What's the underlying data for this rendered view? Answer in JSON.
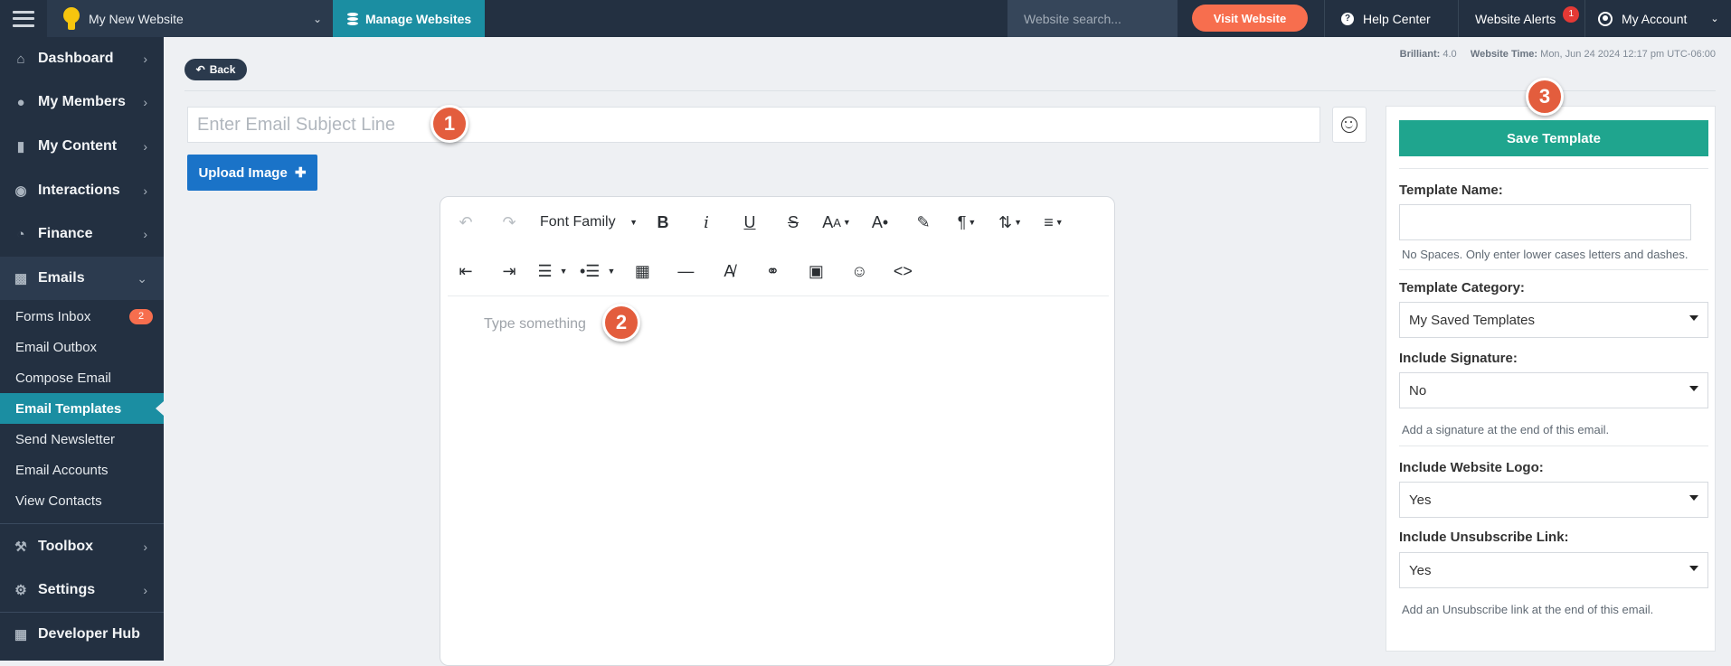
{
  "topbar": {
    "site_name": "My New Website",
    "manage_label": "Manage Websites",
    "search_placeholder": "Website search...",
    "visit_label": "Visit Website",
    "help_label": "Help Center",
    "alerts_label": "Website Alerts",
    "alerts_count": "1",
    "account_label": "My Account"
  },
  "sidebar": {
    "items": [
      {
        "label": "Dashboard",
        "icon": "home-icon"
      },
      {
        "label": "My Members",
        "icon": "users-icon"
      },
      {
        "label": "My Content",
        "icon": "folder-icon"
      },
      {
        "label": "Interactions",
        "icon": "chat-icon"
      },
      {
        "label": "Finance",
        "icon": "pie-chart-icon"
      },
      {
        "label": "Emails",
        "icon": "inbox-icon"
      },
      {
        "label": "Toolbox",
        "icon": "wrench-icon"
      },
      {
        "label": "Settings",
        "icon": "gear-icon"
      },
      {
        "label": "Developer Hub",
        "icon": "grid-icon"
      }
    ],
    "email_sub": [
      {
        "label": "Forms Inbox",
        "badge": "2"
      },
      {
        "label": "Email Outbox"
      },
      {
        "label": "Compose Email"
      },
      {
        "label": "Email Templates"
      },
      {
        "label": "Send Newsletter"
      },
      {
        "label": "Email Accounts"
      },
      {
        "label": "View Contacts"
      }
    ]
  },
  "main": {
    "back_label": "Back",
    "meta_brilliant_label": "Brilliant:",
    "meta_brilliant_value": "4.0",
    "meta_time_label": "Website Time:",
    "meta_time_value": "Mon, Jun 24 2024 12:17 pm UTC-06:00",
    "subject_placeholder": "Enter Email Subject Line",
    "upload_label": "Upload Image",
    "markers": [
      "1",
      "2",
      "3"
    ]
  },
  "editor": {
    "font_family_label": "Font Family",
    "body_placeholder": "Type something"
  },
  "panel": {
    "save_label": "Save Template",
    "template_name_label": "Template Name:",
    "template_name_help": "No Spaces. Only enter lower cases letters and dashes.",
    "template_category_label": "Template Category:",
    "template_category_value": "My Saved Templates",
    "include_signature_label": "Include Signature:",
    "include_signature_value": "No",
    "include_signature_help": "Add a signature at the end of this email.",
    "include_logo_label": "Include Website Logo:",
    "include_logo_value": "Yes",
    "include_unsub_label": "Include Unsubscribe Link:",
    "include_unsub_value": "Yes",
    "include_unsub_help": "Add an Unsubscribe link at the end of this email."
  },
  "colors": {
    "sidebar_bg": "#233041",
    "accent_teal": "#1b8ea2",
    "visit_orange": "#f76e4e",
    "upload_blue": "#1a73c8",
    "save_green": "#1fa58e",
    "marker_red": "#e35d3d"
  }
}
